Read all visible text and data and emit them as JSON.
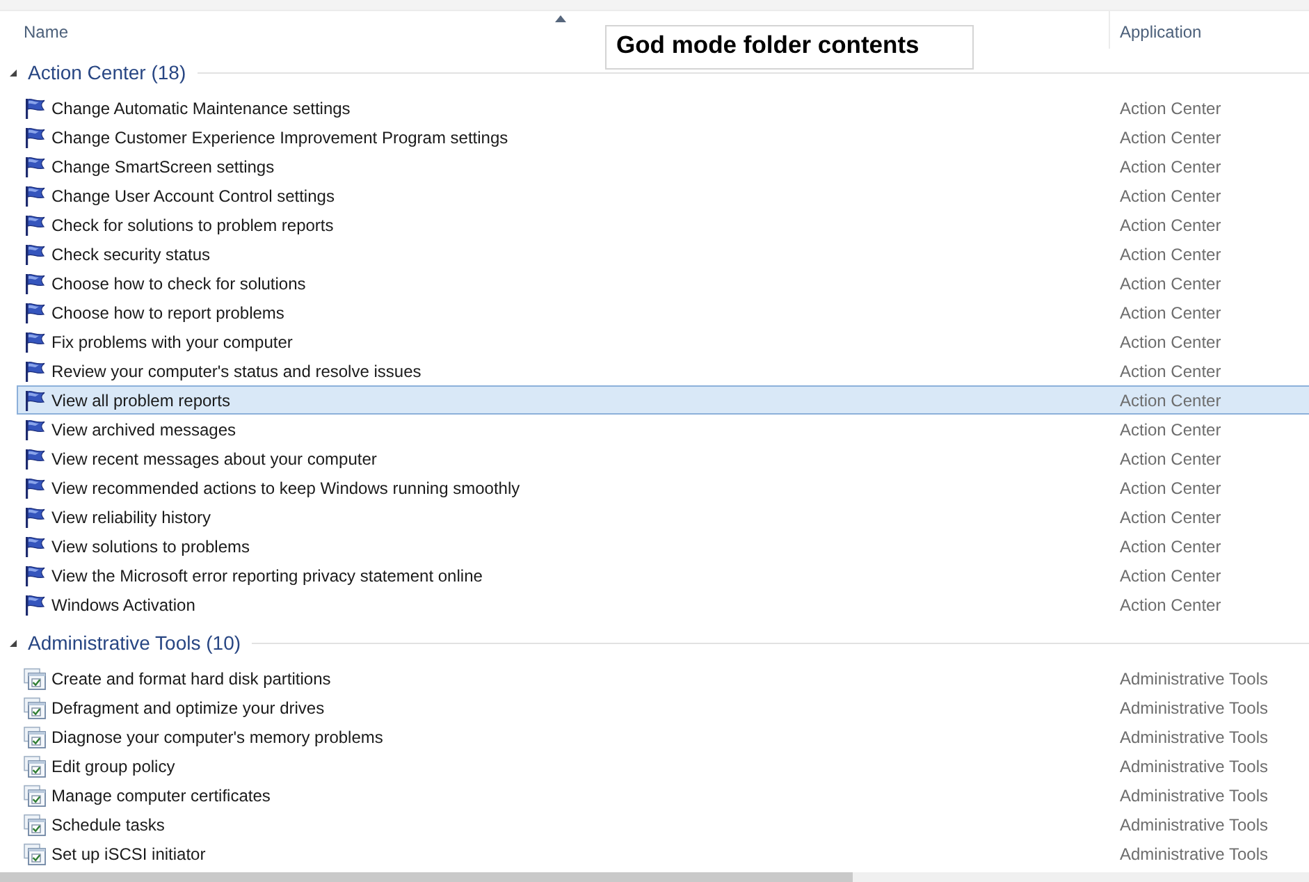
{
  "annotation": {
    "text": "God mode folder contents"
  },
  "columns": [
    {
      "label": "Name",
      "sorted": true
    },
    {
      "label": "Application",
      "sorted": false
    }
  ],
  "groups": [
    {
      "title": "Action Center (18)",
      "expanded": true,
      "items": [
        {
          "name": "Change Automatic Maintenance settings",
          "application": "Action Center",
          "kind": "flag",
          "selected": false
        },
        {
          "name": "Change Customer Experience Improvement Program settings",
          "application": "Action Center",
          "kind": "flag",
          "selected": false
        },
        {
          "name": "Change SmartScreen settings",
          "application": "Action Center",
          "kind": "flag",
          "selected": false
        },
        {
          "name": "Change User Account Control settings",
          "application": "Action Center",
          "kind": "flag",
          "selected": false
        },
        {
          "name": "Check for solutions to problem reports",
          "application": "Action Center",
          "kind": "flag",
          "selected": false
        },
        {
          "name": "Check security status",
          "application": "Action Center",
          "kind": "flag",
          "selected": false
        },
        {
          "name": "Choose how to check for solutions",
          "application": "Action Center",
          "kind": "flag",
          "selected": false
        },
        {
          "name": "Choose how to report problems",
          "application": "Action Center",
          "kind": "flag",
          "selected": false
        },
        {
          "name": "Fix problems with your computer",
          "application": "Action Center",
          "kind": "flag",
          "selected": false
        },
        {
          "name": "Review your computer's status and resolve issues",
          "application": "Action Center",
          "kind": "flag",
          "selected": false
        },
        {
          "name": "View all problem reports",
          "application": "Action Center",
          "kind": "flag",
          "selected": true
        },
        {
          "name": "View archived messages",
          "application": "Action Center",
          "kind": "flag",
          "selected": false
        },
        {
          "name": "View recent messages about your computer",
          "application": "Action Center",
          "kind": "flag",
          "selected": false
        },
        {
          "name": "View recommended actions to keep Windows running smoothly",
          "application": "Action Center",
          "kind": "flag",
          "selected": false
        },
        {
          "name": "View reliability history",
          "application": "Action Center",
          "kind": "flag",
          "selected": false
        },
        {
          "name": "View solutions to problems",
          "application": "Action Center",
          "kind": "flag",
          "selected": false
        },
        {
          "name": "View the Microsoft error reporting privacy statement online",
          "application": "Action Center",
          "kind": "flag",
          "selected": false
        },
        {
          "name": "Windows Activation",
          "application": "Action Center",
          "kind": "flag",
          "selected": false
        }
      ]
    },
    {
      "title": "Administrative Tools (10)",
      "expanded": true,
      "items": [
        {
          "name": "Create and format hard disk partitions",
          "application": "Administrative Tools",
          "kind": "tool",
          "selected": false
        },
        {
          "name": "Defragment and optimize your drives",
          "application": "Administrative Tools",
          "kind": "tool",
          "selected": false
        },
        {
          "name": "Diagnose your computer's memory problems",
          "application": "Administrative Tools",
          "kind": "tool",
          "selected": false
        },
        {
          "name": "Edit group policy",
          "application": "Administrative Tools",
          "kind": "tool",
          "selected": false
        },
        {
          "name": "Manage computer certificates",
          "application": "Administrative Tools",
          "kind": "tool",
          "selected": false
        },
        {
          "name": "Schedule tasks",
          "application": "Administrative Tools",
          "kind": "tool",
          "selected": false
        },
        {
          "name": "Set up iSCSI initiator",
          "application": "Administrative Tools",
          "kind": "tool",
          "selected": false
        }
      ]
    }
  ]
}
